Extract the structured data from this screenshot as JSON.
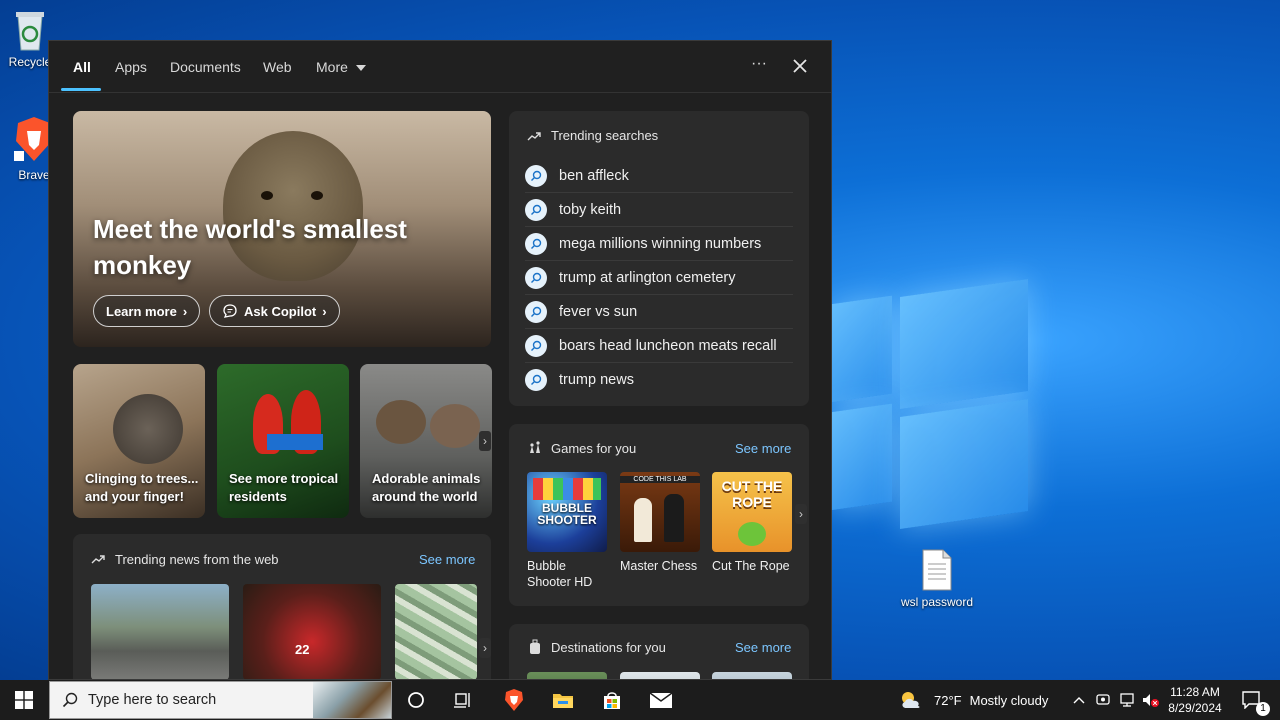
{
  "desktop": {
    "icons": [
      {
        "label": "Recycle",
        "name": "recycle-bin-icon"
      },
      {
        "label": "Brave",
        "name": "brave-browser-icon"
      },
      {
        "label": "wsl password",
        "name": "text-file-icon"
      }
    ]
  },
  "panel": {
    "tabs": [
      {
        "label": "All"
      },
      {
        "label": "Apps"
      },
      {
        "label": "Documents"
      },
      {
        "label": "Web"
      },
      {
        "label": "More"
      }
    ],
    "more_icon": "ellipsis-icon",
    "close_icon": "close-icon",
    "hero": {
      "title": "Meet the world's smallest monkey",
      "learn_more": "Learn more",
      "ask_copilot": "Ask Copilot"
    },
    "cards": [
      {
        "caption": "Clinging to trees... and your finger!"
      },
      {
        "caption": "See more tropical residents"
      },
      {
        "caption": "Adorable animals around the world"
      }
    ],
    "news": {
      "title": "Trending news from the web",
      "see_more": "See more"
    },
    "trending": {
      "title": "Trending searches",
      "items": [
        "ben affleck",
        "toby keith",
        "mega millions winning numbers",
        "trump at arlington cemetery",
        "fever vs sun",
        "boars head luncheon meats recall",
        "trump news"
      ]
    },
    "games": {
      "title": "Games for you",
      "see_more": "See more",
      "items": [
        {
          "name": "Bubble Shooter HD",
          "art": "BUBBLE SHOOTER"
        },
        {
          "name": "Master Chess",
          "art": "CODE THIS LAB"
        },
        {
          "name": "Cut The Rope",
          "art": "CUT THE ROPE"
        }
      ]
    },
    "destinations": {
      "title": "Destinations for you",
      "see_more": "See more"
    }
  },
  "taskbar": {
    "search_placeholder": "Type here to search",
    "weather": "72°F",
    "weather_desc": "Mostly cloudy",
    "time": "11:28 AM",
    "date": "8/29/2024",
    "notifications": "1"
  }
}
